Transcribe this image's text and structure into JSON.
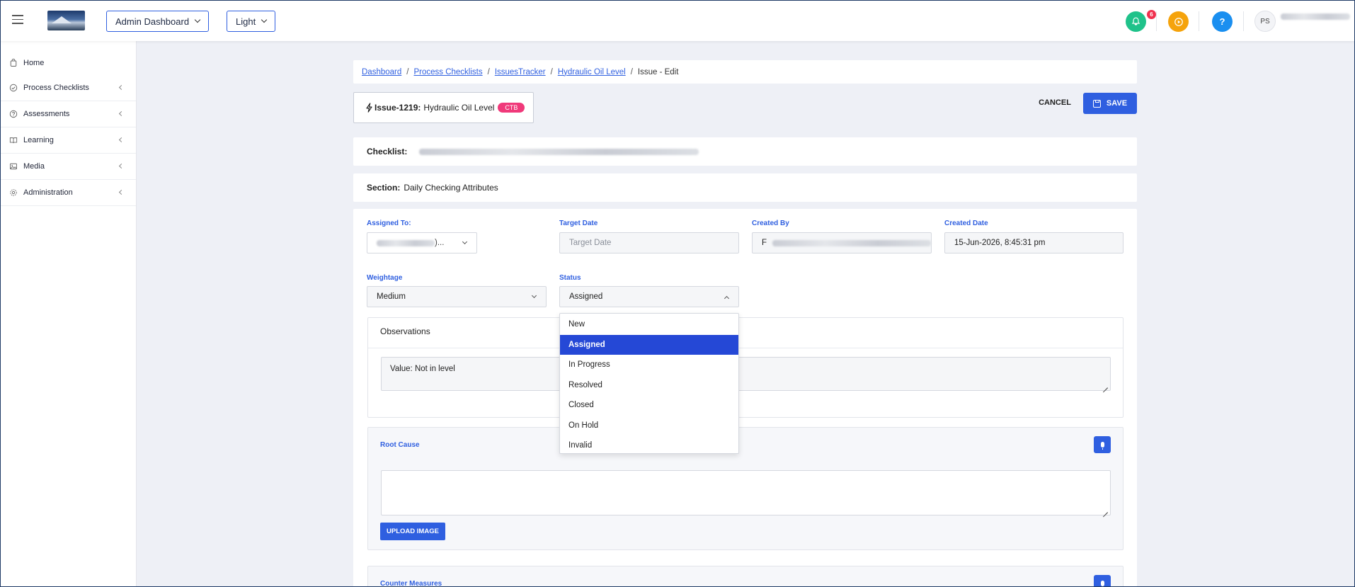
{
  "topbar": {
    "dashboard_select": "Admin Dashboard",
    "theme_select": "Light",
    "notification_count": "6",
    "help_label": "?",
    "user_initials": "PS"
  },
  "sidebar": {
    "items": [
      {
        "label": "Home",
        "icon": "home-icon"
      },
      {
        "label": "Process Checklists",
        "icon": "check-circle-icon"
      },
      {
        "label": "Assessments",
        "icon": "question-circle-icon"
      },
      {
        "label": "Learning",
        "icon": "book-icon"
      },
      {
        "label": "Media",
        "icon": "image-icon"
      },
      {
        "label": "Administration",
        "icon": "gear-icon"
      }
    ]
  },
  "breadcrumb": {
    "items": [
      "Dashboard",
      "Process Checklists",
      "IssuesTracker",
      "Hydraulic Oil Level"
    ],
    "current": "Issue - Edit"
  },
  "issue": {
    "id": "Issue-1219:",
    "title": "Hydraulic Oil Level",
    "tag": "CTB"
  },
  "actions": {
    "cancel": "CANCEL",
    "save": "SAVE"
  },
  "checklist": {
    "label": "Checklist:"
  },
  "section": {
    "label": "Section:",
    "value": "Daily Checking Attributes"
  },
  "form": {
    "assigned_to_label": "Assigned To:",
    "assigned_to_suffix": ")...",
    "target_date_label": "Target Date",
    "target_date_placeholder": "Target Date",
    "created_by_label": "Created By",
    "created_by_initial": "F",
    "created_date_label": "Created Date",
    "created_date_value": "15-Jun-2026, 8:45:31 pm",
    "weightage_label": "Weightage",
    "weightage_value": "Medium",
    "status_label": "Status",
    "status_value": "Assigned"
  },
  "status_options": [
    "New",
    "Assigned",
    "In Progress",
    "Resolved",
    "Closed",
    "On Hold",
    "Invalid"
  ],
  "observations": {
    "title": "Observations",
    "value": "Value: Not in level"
  },
  "root_cause": {
    "title": "Root Cause",
    "upload_label": "UPLOAD IMAGE"
  },
  "counter_measures": {
    "title": "Counter Measures"
  },
  "colors": {
    "accent": "#2f5fe0",
    "notification": "#1fc28a",
    "play": "#f5a30c",
    "help": "#1a8ff0",
    "tag": "#f0397a",
    "selected_option": "#2548d6"
  }
}
